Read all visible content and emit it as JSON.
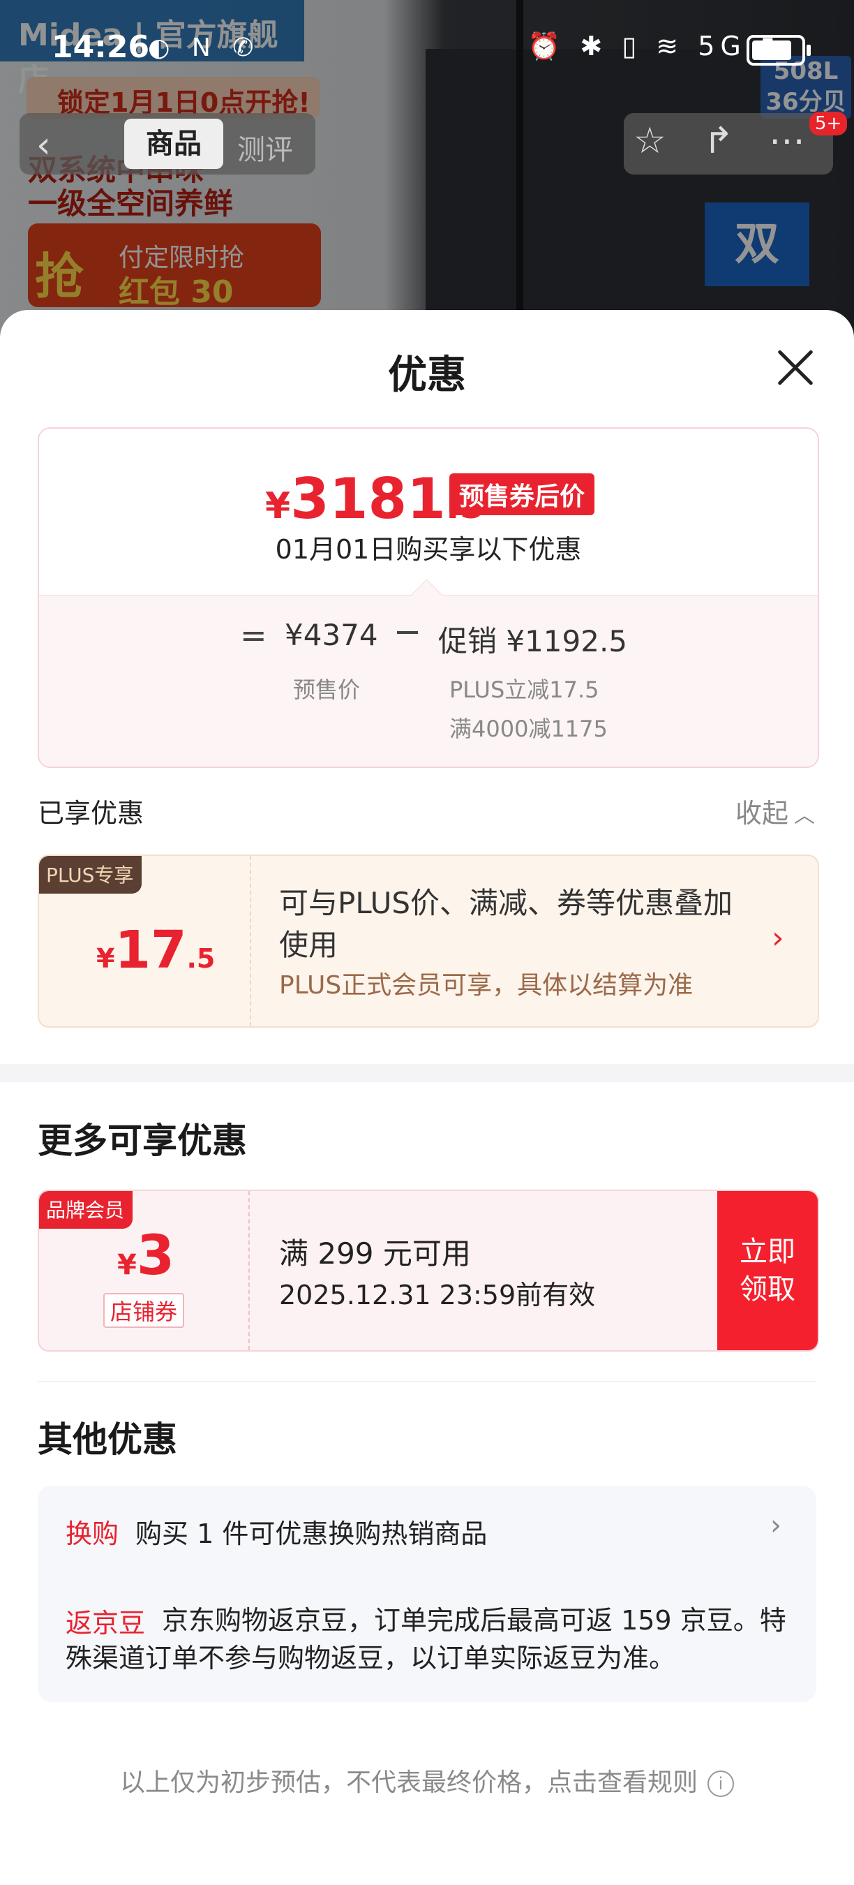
{
  "status_bar": {
    "time": "14:26",
    "left_icons": "◐ N ✆",
    "right_icons": "⏰ ✱ ▯ ≋ 5G ▮"
  },
  "background": {
    "brand": "Midea | 官方旗舰店",
    "promo_lock": "锁定1月1日0点开抢!",
    "promo_line1": "双系统中串味",
    "promo_line2": "一级全空间养鲜",
    "promo_grab": "抢",
    "promo_limit": "付定限时抢",
    "promo_redpack": "红包 30",
    "spec_tag": "508L 36分贝",
    "arrow_text": "双"
  },
  "nav": {
    "back_icon": "back-icon",
    "tab_active": "商品",
    "tab_inactive": "测评",
    "cart_badge": "5+"
  },
  "sheet": {
    "title": "优惠",
    "price": {
      "currency": "¥",
      "integer": "3181",
      "decimal": ".5",
      "tag": "预售券后价",
      "note": "01月01日购买享以下优惠",
      "equals": "=",
      "presale_value": "¥4374",
      "presale_label": "预售价",
      "minus": "−",
      "promo_value": "促销 ¥1192.5",
      "promo_line1": "PLUS立减17.5",
      "promo_line2": "满4000减1175"
    },
    "enjoyed": {
      "title": "已享优惠",
      "collapse_label": "收起",
      "plus": {
        "badge": "PLUS专享",
        "currency": "¥",
        "integer": "17",
        "decimal": ".5",
        "line1": "可与PLUS价、满减、券等优惠叠加使用",
        "line2": "PLUS正式会员可享，具体以结算为准"
      }
    },
    "more": {
      "title": "更多可享优惠",
      "coupon": {
        "badge": "品牌会员",
        "currency": "¥",
        "amount": "3",
        "type": "店铺券",
        "condition": "满 299 元可用",
        "validity": "2025.12.31 23:59前有效",
        "button": "立即领取"
      }
    },
    "other": {
      "title": "其他优惠",
      "item1_key": "换购",
      "item1_text": "购买 1 件可优惠换购热销商品",
      "item2_key": "返京豆",
      "item2_text": "京东购物返京豆，订单完成后最高可返 159 京豆。特殊渠道订单不参与购物返豆，以订单实际返豆为准。"
    },
    "disclaimer": "以上仅为初步预估，不代表最终价格，点击查看规则"
  },
  "colors": {
    "accent": "#e8232f",
    "plus_bg": "#fdf4ec",
    "coupon_bg": "#fdf2f3"
  }
}
